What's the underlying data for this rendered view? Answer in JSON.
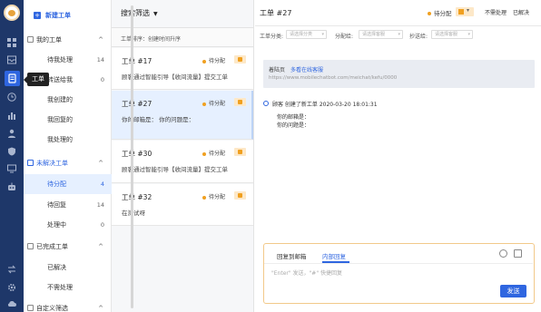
{
  "tooltip": "工单",
  "nav": {
    "new_ticket": "新建工单",
    "groups": [
      {
        "label": "我的工单",
        "items": [
          {
            "label": "待我处理",
            "count": "14"
          },
          {
            "label": "转送给我",
            "count": "0"
          },
          {
            "label": "我创建的",
            "count": ""
          },
          {
            "label": "我回复的",
            "count": ""
          },
          {
            "label": "我处理的",
            "count": ""
          }
        ]
      },
      {
        "label": "未解决工单",
        "items": [
          {
            "label": "待分配",
            "count": "4"
          },
          {
            "label": "待回复",
            "count": "14"
          },
          {
            "label": "处理中",
            "count": "0"
          }
        ]
      },
      {
        "label": "已完成工单",
        "items": [
          {
            "label": "已解决",
            "count": ""
          },
          {
            "label": "不需处理",
            "count": ""
          }
        ]
      },
      {
        "label": "自定义筛选",
        "items": []
      }
    ]
  },
  "list": {
    "filter_label": "搜索筛选",
    "sort_label": "工单排序：创建时间升序",
    "cards": [
      {
        "title": "工单 #17",
        "status": "待分配",
        "desc": "顾客通过智能引导【收间流量】提交工单"
      },
      {
        "title": "工单 #27",
        "status": "待分配",
        "desc": "你的邮箱是：  你的问题是："
      },
      {
        "title": "工单 #30",
        "status": "待分配",
        "desc": "顾客通过智能引导【收间流量】提交工单"
      },
      {
        "title": "工单 #32",
        "status": "待分配",
        "desc": "在测试呀"
      }
    ]
  },
  "detail": {
    "title": "工单 #27",
    "status": "待分配",
    "action_ignore": "不需处理",
    "action_resolve": "已解决",
    "fields": [
      {
        "label": "工单分类:",
        "placeholder": "请选择分类"
      },
      {
        "label": "分配给:",
        "placeholder": "请选择客服"
      },
      {
        "label": "抄送给:",
        "placeholder": "请选择客服"
      }
    ],
    "banner": {
      "label": "着陆页",
      "link": "多看在线客服",
      "url": "https://www.mobilechatbot.com/meichat/kefu/0000"
    },
    "message": {
      "who": "顾客 创建了新工单 2020-03-20 18:01:31",
      "line1": "你的邮箱是：",
      "line2": "你的问题是："
    },
    "composer": {
      "tab1": "回复到邮箱",
      "tab2": "内部回复",
      "placeholder": "\"Enter\" 发送，\"#\" 快捷回复",
      "send": "发送"
    }
  }
}
